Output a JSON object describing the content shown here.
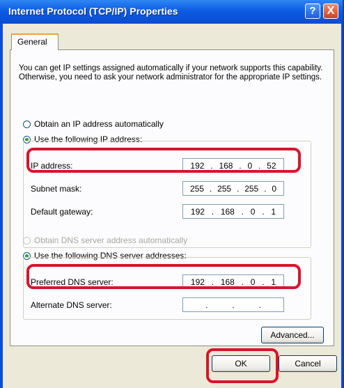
{
  "window": {
    "title": "Internet Protocol (TCP/IP) Properties",
    "help_label": "?",
    "close_label": "X"
  },
  "tabs": [
    {
      "label": "General"
    }
  ],
  "intro_text": "You can get IP settings assigned automatically if your network supports this capability. Otherwise, you need to ask your network administrator for the appropriate IP settings.",
  "ip_section": {
    "auto_label": "Obtain an IP address automatically",
    "manual_label": "Use the following IP address:",
    "selected": "manual",
    "fields": [
      {
        "label": "IP address:",
        "octets": [
          "192",
          "168",
          "0",
          "52"
        ]
      },
      {
        "label": "Subnet mask:",
        "octets": [
          "255",
          "255",
          "255",
          "0"
        ]
      },
      {
        "label": "Default gateway:",
        "octets": [
          "192",
          "168",
          "0",
          "1"
        ]
      }
    ]
  },
  "dns_section": {
    "auto_label": "Obtain DNS server address automatically",
    "manual_label": "Use the following DNS server addresses:",
    "selected": "manual",
    "fields": [
      {
        "label": "Preferred DNS server:",
        "octets": [
          "192",
          "168",
          "0",
          "1"
        ]
      },
      {
        "label": "Alternate DNS server:",
        "octets": [
          "",
          "",
          "",
          ""
        ]
      }
    ]
  },
  "buttons": {
    "advanced": "Advanced...",
    "ok": "OK",
    "cancel": "Cancel"
  },
  "colors": {
    "highlight": "#d8142c",
    "titlebar": "#0d5ce3",
    "dialog_bg": "#ece9d8"
  }
}
